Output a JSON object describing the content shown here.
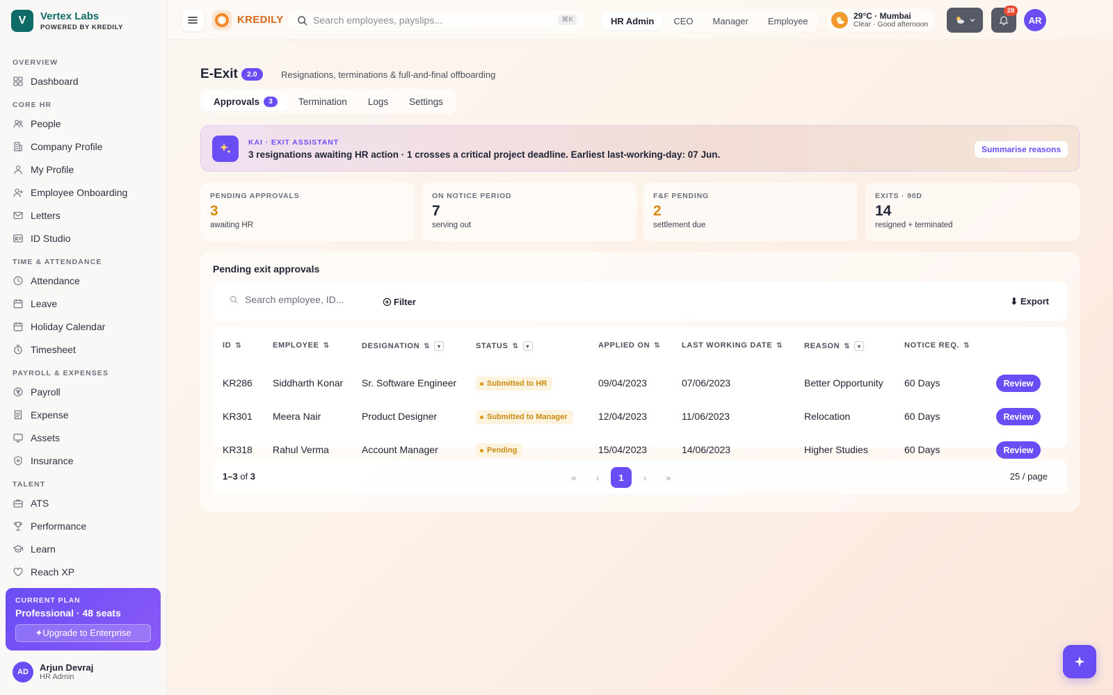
{
  "brand": {
    "initial": "V",
    "name": "Vertex Labs",
    "subtitle": "POWERED BY KREDILY"
  },
  "sidebar": {
    "sections": [
      {
        "title": "OVERVIEW",
        "items": [
          {
            "label": "Dashboard",
            "icon": "grid-icon"
          }
        ]
      },
      {
        "title": "CORE HR",
        "items": [
          {
            "label": "People",
            "icon": "people-icon"
          },
          {
            "label": "Company Profile",
            "icon": "building-icon"
          },
          {
            "label": "My Profile",
            "icon": "user-icon"
          },
          {
            "label": "Employee Onboarding",
            "icon": "user-plus-icon"
          },
          {
            "label": "Letters",
            "icon": "mail-icon"
          },
          {
            "label": "ID Studio",
            "icon": "id-card-icon"
          }
        ]
      },
      {
        "title": "TIME & ATTENDANCE",
        "items": [
          {
            "label": "Attendance",
            "icon": "clock-icon"
          },
          {
            "label": "Leave",
            "icon": "calendar-icon"
          },
          {
            "label": "Holiday Calendar",
            "icon": "calendar-icon"
          },
          {
            "label": "Timesheet",
            "icon": "timer-icon"
          }
        ]
      },
      {
        "title": "PAYROLL & EXPENSES",
        "items": [
          {
            "label": "Payroll",
            "icon": "currency-icon"
          },
          {
            "label": "Expense",
            "icon": "receipt-icon"
          },
          {
            "label": "Assets",
            "icon": "monitor-icon"
          },
          {
            "label": "Insurance",
            "icon": "shield-icon"
          }
        ]
      },
      {
        "title": "TALENT",
        "items": [
          {
            "label": "ATS",
            "icon": "briefcase-icon"
          },
          {
            "label": "Performance",
            "icon": "trophy-icon"
          },
          {
            "label": "Learn",
            "icon": "graduation-cap-icon"
          },
          {
            "label": "Reach XP",
            "icon": "heart-icon"
          }
        ]
      }
    ],
    "plan": {
      "label": "CURRENT PLAN",
      "name": "Professional · 48 seats",
      "upgrade": "✦Upgrade to Enterprise"
    },
    "user": {
      "initials": "AD",
      "name": "Arjun Devraj",
      "role": "HR Admin"
    }
  },
  "topbar": {
    "product": "KREDILY",
    "search_placeholder": "Search employees, payslips...",
    "shortcut": "⌘K",
    "roles": [
      "HR Admin",
      "CEO",
      "Manager",
      "Employee"
    ],
    "active_role": "HR Admin",
    "weather": {
      "temp": "29°C · Mumbai",
      "desc": "Clear · Good afternoon"
    },
    "notifications": "28",
    "avatar": "AR"
  },
  "page": {
    "title": "E-Exit",
    "version": "2.0",
    "subtitle": "Resignations, terminations & full-and-final offboarding",
    "tabs": [
      {
        "label": "Approvals",
        "count": "3"
      },
      {
        "label": "Termination"
      },
      {
        "label": "Logs"
      },
      {
        "label": "Settings"
      }
    ]
  },
  "assistant": {
    "label": "KAI · EXIT ASSISTANT",
    "message": "3 resignations awaiting HR action · 1 crosses a critical project deadline. Earliest last-working-day: 07 Jun.",
    "action": "Summarise reasons"
  },
  "stats": [
    {
      "label": "PENDING APPROVALS",
      "value": "3",
      "sub": "awaiting HR",
      "color": "#d98a12"
    },
    {
      "label": "ON NOTICE PERIOD",
      "value": "7",
      "sub": "serving out",
      "color": "#1f2333"
    },
    {
      "label": "F&F PENDING",
      "value": "2",
      "sub": "settlement due",
      "color": "#d98a12"
    },
    {
      "label": "EXITS · 90D",
      "value": "14",
      "sub": "resigned + terminated",
      "color": "#1f2333"
    }
  ],
  "table": {
    "title": "Pending exit approvals",
    "search_placeholder": "Search employee, ID...",
    "filter": "Filter",
    "export": "⬇ Export",
    "columns": [
      "ID",
      "EMPLOYEE",
      "DESIGNATION",
      "STATUS",
      "APPLIED ON",
      "LAST WORKING DATE",
      "REASON",
      "NOTICE REQ."
    ],
    "rows": [
      {
        "id": "KR286",
        "employee": "Siddharth Konar",
        "designation": "Sr. Software Engineer",
        "status": "Submitted to HR",
        "applied": "09/04/2023",
        "lwd": "07/06/2023",
        "reason": "Better Opportunity",
        "notice": "60 Days",
        "action": "Review"
      },
      {
        "id": "KR301",
        "employee": "Meera Nair",
        "designation": "Product Designer",
        "status": "Submitted to Manager",
        "applied": "12/04/2023",
        "lwd": "11/06/2023",
        "reason": "Relocation",
        "notice": "60 Days",
        "action": "Review"
      },
      {
        "id": "KR318",
        "employee": "Rahul Verma",
        "designation": "Account Manager",
        "status": "Pending",
        "applied": "15/04/2023",
        "lwd": "14/06/2023",
        "reason": "Higher Studies",
        "notice": "60 Days",
        "action": "Review"
      }
    ],
    "pagination": {
      "range": "1–3",
      "of": "of",
      "total": "3",
      "current": "1",
      "page_size": "25 / page"
    }
  },
  "colors": {
    "accent": "#6a4df5",
    "brand": "#0f6b67",
    "warning": "#d98a12"
  }
}
